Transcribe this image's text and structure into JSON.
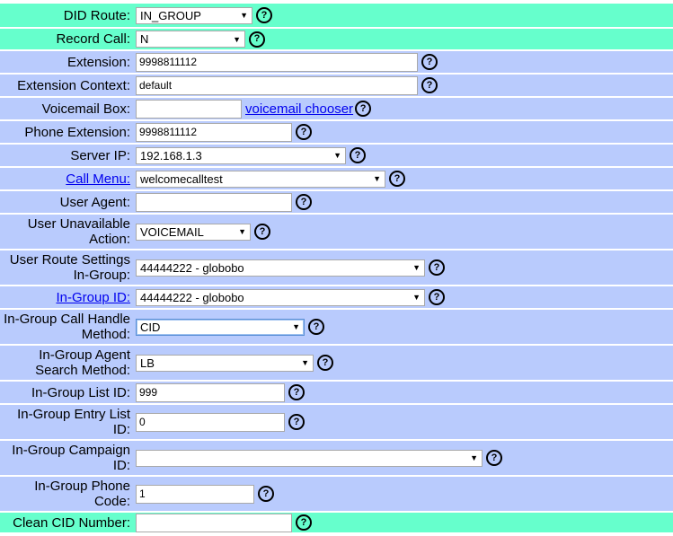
{
  "help_glyph": "?",
  "rows": {
    "did_route": {
      "label": "DID Route:",
      "value": "IN_GROUP"
    },
    "record_call": {
      "label": "Record Call:",
      "value": "N"
    },
    "extension": {
      "label": "Extension:",
      "value": "9998811112"
    },
    "extension_context": {
      "label": "Extension Context:",
      "value": "default"
    },
    "voicemail_box": {
      "label": "Voicemail Box:",
      "value": "",
      "link": "voicemail chooser"
    },
    "phone_extension": {
      "label": "Phone Extension:",
      "value": "9998811112"
    },
    "server_ip": {
      "label": "Server IP:",
      "value": "192.168.1.3"
    },
    "call_menu": {
      "label": "Call Menu:",
      "value": "welcomecalltest"
    },
    "user_agent": {
      "label": "User Agent:",
      "value": ""
    },
    "user_unavailable_action": {
      "label": "User Unavailable Action:",
      "value": "VOICEMAIL"
    },
    "user_route_settings": {
      "label": "User Route Settings In-Group:",
      "value": "44444222 - globobo"
    },
    "in_group_id": {
      "label": "In-Group ID:",
      "value": "44444222 - globobo"
    },
    "in_group_call_handle": {
      "label": "In-Group Call Handle Method:",
      "value": "CID"
    },
    "in_group_agent_search": {
      "label": "In-Group Agent Search Method:",
      "value": "LB"
    },
    "in_group_list_id": {
      "label": "In-Group List ID:",
      "value": "999"
    },
    "in_group_entry_list_id": {
      "label": "In-Group Entry List ID:",
      "value": "0"
    },
    "in_group_campaign_id": {
      "label": "In-Group Campaign ID:",
      "value": ""
    },
    "in_group_phone_code": {
      "label": "In-Group Phone Code:",
      "value": "1"
    },
    "clean_cid_number": {
      "label": "Clean CID Number:",
      "value": ""
    }
  }
}
